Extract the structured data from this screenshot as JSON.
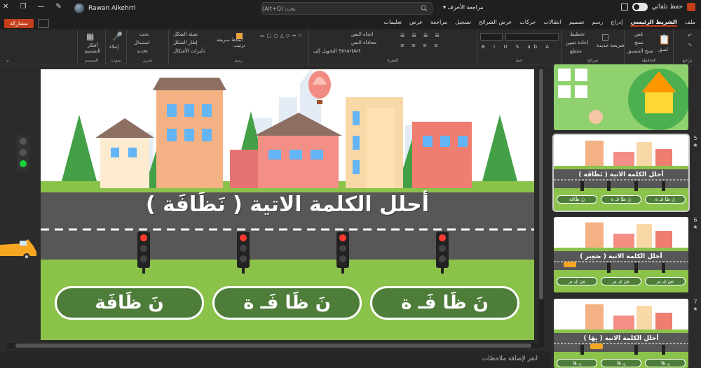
{
  "titlebar": {
    "autosave_label": "حفظ تلقائي",
    "search_placeholder": "بحث (Alt+Q)",
    "review_label": "مراجعة الأخرف",
    "user_name": "Rawan Alkehrri"
  },
  "menubar": {
    "share_label": "مشاركة",
    "tabs": [
      "ملف",
      "الشريط الرئيسي",
      "إدراج",
      "رسم",
      "تصميم",
      "انتقالات",
      "حركات",
      "عرض الشرائح",
      "تسجيل",
      "مراجعة",
      "عرض",
      "تعليمات"
    ],
    "active_tab": "الشريط الرئيسي"
  },
  "ribbon": {
    "groups": [
      {
        "label": "تراجع",
        "items": []
      },
      {
        "label": "الحافظة",
        "items": [
          "لصق",
          "قص",
          "نسخ",
          "نسخ التنسيق"
        ]
      },
      {
        "label": "شرائح",
        "items": [
          "شريحة جديدة",
          "تخطيط",
          "إعادة تعيين",
          "مقطع"
        ]
      },
      {
        "label": "خط",
        "items": []
      },
      {
        "label": "الفقرة",
        "items": [
          "اتجاه النص",
          "محاذاة النص",
          "التحويل إلى SmartArt"
        ]
      },
      {
        "label": "رسم",
        "items": [
          "ترتيب",
          "أنماط سريعة",
          "تعبئة الشكل",
          "إطار الشكل",
          "تأثيرات الأشكال"
        ]
      },
      {
        "label": "تحرير",
        "items": [
          "بحث",
          "استبدال",
          "تحديد"
        ]
      },
      {
        "label": "صوت",
        "items": [
          "إملاء"
        ]
      },
      {
        "label": "المصمم",
        "items": [
          "أفكار التصميم"
        ]
      }
    ]
  },
  "slide": {
    "title": "أحلل الكلمة الاتية ( نَظَافَة )",
    "answers": [
      "نَ ظَا فَـ ة",
      "نَ ظَا فَـ ة",
      "نَ ظَافَة"
    ]
  },
  "thumbnails": [
    {
      "number": "",
      "title": "",
      "answers": []
    },
    {
      "number": "5",
      "title": "أحلل الكلمة الاتية ( نَظَافَة )",
      "answers": [
        "نَ ظَا فَـ ة",
        "نَ ظَا فَـ ة",
        "نَ ظَافَة"
      ]
    },
    {
      "number": "6",
      "title": "أحلل الكلمة الاتية ( صَغِير )",
      "answers": [
        "صَ غِـ ير",
        "صَ غِـ ير",
        "صَ غِـ ير"
      ]
    },
    {
      "number": "7",
      "title": "أحلل الكلمة الاتية ( بِهَا )",
      "answers": [
        "بِـ هَا",
        "بِـ هَا",
        "بِـ هَا"
      ]
    }
  ],
  "statusbar": {
    "notes_placeholder": "انقر لإضافة ملاحظات"
  },
  "colors": {
    "share": "#c43e1c",
    "grass": "#8bc34a",
    "road": "#555555",
    "answer_button": "#4e7d3a"
  }
}
